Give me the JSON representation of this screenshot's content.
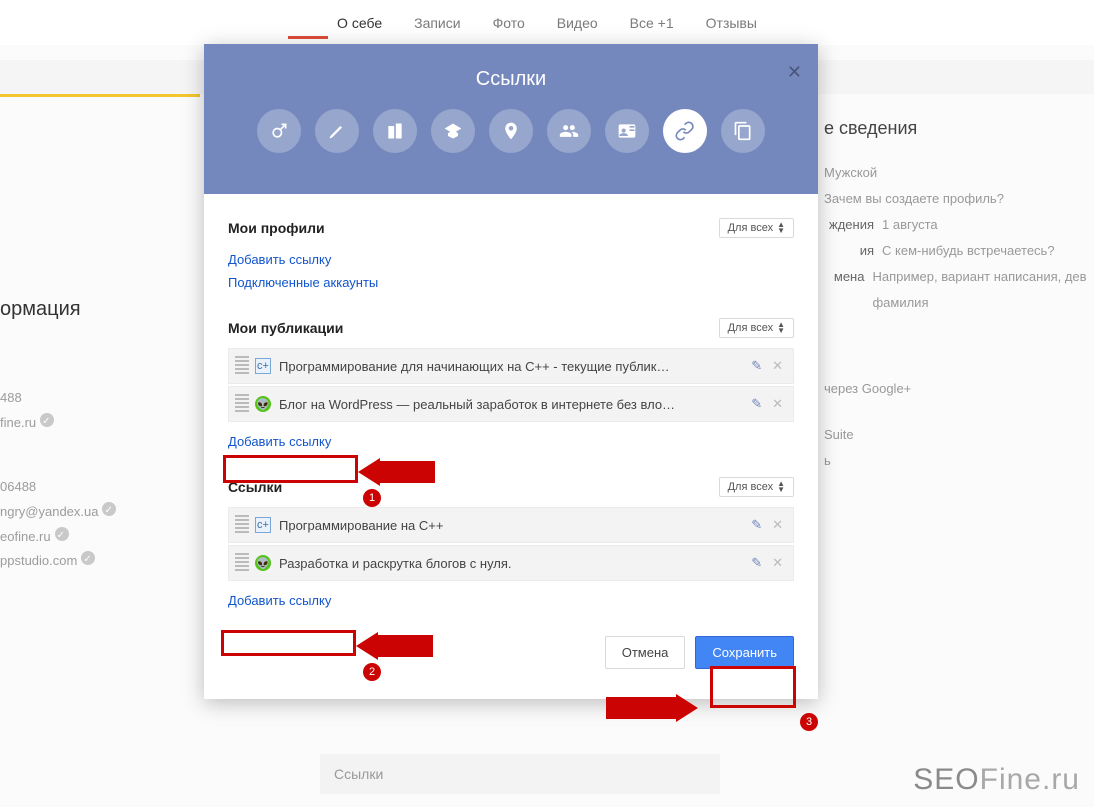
{
  "nav": {
    "about": "О себе",
    "posts": "Записи",
    "photos": "Фото",
    "videos": "Видео",
    "plus": "Все +1",
    "reviews": "Отзывы"
  },
  "modal": {
    "title": "Ссылки",
    "sections": {
      "profiles": {
        "title": "Мои профили",
        "visibility": "Для всех",
        "add": "Добавить ссылку",
        "connected": "Подключенные аккаунты"
      },
      "publications": {
        "title": "Мои публикации",
        "visibility": "Для всех",
        "items": [
          "Программирование для начинающих на C++ - текущие публик…",
          "Блог на WordPress — реальный заработок в интернете без вло…"
        ],
        "add": "Добавить ссылку"
      },
      "links": {
        "title": "Ссылки",
        "visibility": "Для всех",
        "items": [
          "Программирование на C++",
          "Разработка и раскрутка блогов с нуля."
        ],
        "add": "Добавить ссылку"
      }
    },
    "buttons": {
      "cancel": "Отмена",
      "save": "Сохранить"
    }
  },
  "right": {
    "header": "е сведения",
    "gender": "Мужской",
    "why": "Зачем вы создаете профиль?",
    "bday_lab": "ждения",
    "bday": "1 августа",
    "rel_lab": "ия",
    "rel": "С кем-нибудь встречаетесь?",
    "names_lab": "мена",
    "names": "Например, вариант написания, дев фамилия",
    "via": "через Google+",
    "suite": "Suite",
    "share": "ь"
  },
  "left": {
    "info": "ормация",
    "phone": "488",
    "site1": "fine.ru",
    "phone2": "06488",
    "email": "ngry@yandex.ua",
    "site2": "eofine.ru",
    "site3": "ppstudio.com"
  },
  "bottom": {
    "links": "Ссылки"
  },
  "annotations": {
    "n1": "1",
    "n2": "2",
    "n3": "3"
  },
  "brand": {
    "seo": "SEO",
    "fine": "Fine.ru"
  }
}
